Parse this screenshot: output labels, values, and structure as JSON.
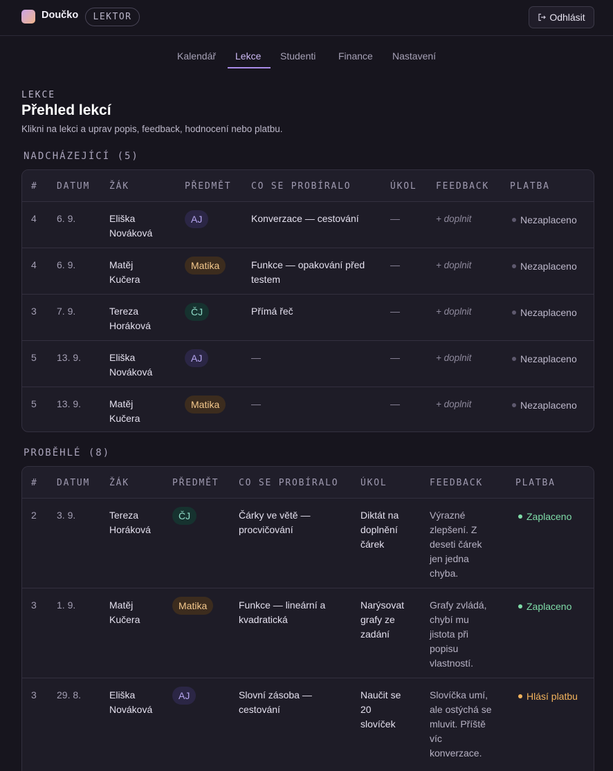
{
  "app": {
    "brand": "Doučko",
    "role": "LEKTOR",
    "logout_label": "Odhlásit"
  },
  "nav": {
    "items": [
      "Kalendář",
      "Lekce",
      "Studenti",
      "Finance",
      "Nastavení"
    ],
    "active": "Lekce"
  },
  "page": {
    "eyebrow": "LEKCE",
    "title": "Přehled lekcí",
    "subtitle": "Klikni na lekci a uprav popis, feedback, hodnocení nebo platbu."
  },
  "upcoming": {
    "label": "NADCHÁZEJÍCÍ (5)",
    "headers": [
      "#",
      "DATUM",
      "ŽÁK",
      "PŘEDMĚT",
      "CO SE PROBÍRALO",
      "ÚKOL",
      "FEEDBACK",
      "PLATBA"
    ],
    "rows": [
      {
        "num": "4",
        "date": "6. 9.",
        "student": [
          "Eliška",
          "Nováková"
        ],
        "subject": "AJ",
        "topic": [
          "Konverzace — cestování"
        ],
        "task": "—",
        "feedback": "+ doplnit",
        "payment": "Nezaplaceno"
      },
      {
        "num": "4",
        "date": "6. 9.",
        "student": [
          "Matěj",
          "Kučera"
        ],
        "subject": "Matika",
        "topic": [
          "Funkce — opakování před",
          "testem"
        ],
        "task": "—",
        "feedback": "+ doplnit",
        "payment": "Nezaplaceno"
      },
      {
        "num": "3",
        "date": "7. 9.",
        "student": [
          "Tereza",
          "Horáková"
        ],
        "subject": "ČJ",
        "topic": [
          "Přímá řeč"
        ],
        "task": "—",
        "feedback": "+ doplnit",
        "payment": "Nezaplaceno"
      },
      {
        "num": "5",
        "date": "13. 9.",
        "student": [
          "Eliška",
          "Nováková"
        ],
        "subject": "AJ",
        "topic": [
          "—"
        ],
        "task": "—",
        "feedback": "+ doplnit",
        "payment": "Nezaplaceno"
      },
      {
        "num": "5",
        "date": "13. 9.",
        "student": [
          "Matěj",
          "Kučera"
        ],
        "subject": "Matika",
        "topic": [
          "—"
        ],
        "task": "—",
        "feedback": "+ doplnit",
        "payment": "Nezaplaceno"
      }
    ]
  },
  "past": {
    "label": "PROBĚHLÉ (8)",
    "headers": [
      "#",
      "DATUM",
      "ŽÁK",
      "PŘEDMĚT",
      "CO SE PROBÍRALO",
      "ÚKOL",
      "FEEDBACK",
      "PLATBA"
    ],
    "rows": [
      {
        "num": "2",
        "date": "3. 9.",
        "student": [
          "Tereza",
          "Horáková"
        ],
        "subject": "ČJ",
        "topic": [
          "Čárky ve větě —",
          "procvičování"
        ],
        "task": [
          "Diktát na",
          "doplnění",
          "čárek"
        ],
        "feedback": [
          "Výrazné",
          "zlepšení. Z",
          "deseti čárek",
          "jen jedna",
          "chyba."
        ],
        "payment": "Zaplaceno",
        "payment_state": "paid"
      },
      {
        "num": "3",
        "date": "1. 9.",
        "student": [
          "Matěj",
          "Kučera"
        ],
        "subject": "Matika",
        "topic": [
          "Funkce — lineární a",
          "kvadratická"
        ],
        "task": [
          "Narýsovat",
          "grafy ze",
          "zadání"
        ],
        "feedback": [
          "Grafy zvládá,",
          "chybí mu",
          "jistota při",
          "popisu",
          "vlastností."
        ],
        "payment": "Zaplaceno",
        "payment_state": "paid"
      },
      {
        "num": "3",
        "date": "29. 8.",
        "student": [
          "Eliška",
          "Nováková"
        ],
        "subject": "AJ",
        "topic": [
          "Slovní zásoba —",
          "cestování"
        ],
        "task": [
          "Naučit se",
          "20",
          "slovíček"
        ],
        "feedback": [
          "Slovíčka umí,",
          "ale ostýchá se",
          "mluvit. Příště",
          "víc",
          "konverzace."
        ],
        "payment": "Hlásí platbu",
        "payment_state": "claim"
      }
    ]
  },
  "colors": {
    "background": "#17151e",
    "accent": "#a98ce8",
    "paid": "#7fdca8",
    "claim": "#f3b35c",
    "unpaid_dot": "#5e596e"
  }
}
